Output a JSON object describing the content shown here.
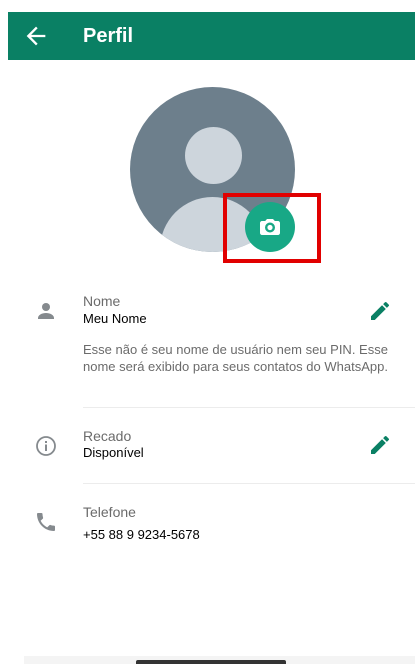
{
  "header": {
    "title": "Perfil",
    "back_icon": "arrow-left-icon"
  },
  "colors": {
    "header_bg": "#0a8064",
    "accent": "#18a886",
    "highlight": "#e10000"
  },
  "avatar": {
    "camera_icon": "camera-icon"
  },
  "name": {
    "label": "Nome",
    "value": "Meu Nome",
    "description": "Esse não é seu nome de usuário nem seu PIN. Esse nome será exibido para seus contatos do WhatsApp."
  },
  "about": {
    "label": "Recado",
    "value": "Disponível"
  },
  "phone": {
    "label": "Telefone",
    "value": "+55 88 9 9234-5678"
  }
}
